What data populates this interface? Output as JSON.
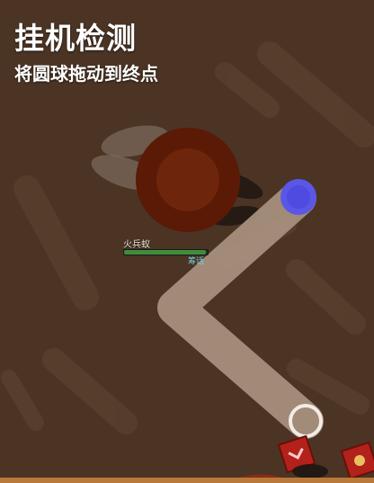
{
  "overlay": {
    "title": "挂机检测",
    "subtitle": "将圆球拖动到终点"
  },
  "unit": {
    "name": "火兵蚁",
    "tag": "筹话",
    "hp_fraction": 0.98
  },
  "colors": {
    "background": "#4a3322",
    "path": "#a89280",
    "drag_ball": "#5a56e6",
    "target_ring": "#f2ece4",
    "enemy": "#5a1a06",
    "hp": "#3f8d3b"
  }
}
